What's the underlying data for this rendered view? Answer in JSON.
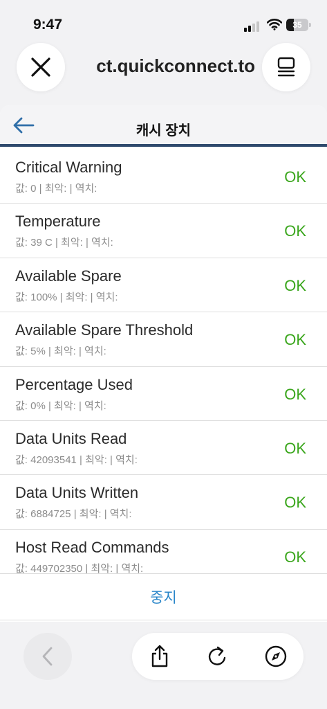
{
  "status_bar": {
    "time": "9:47",
    "battery": "35",
    "battery_level": 0.35
  },
  "browser": {
    "url": "ct.quickconnect.to"
  },
  "page": {
    "title": "캐시 장치"
  },
  "attributes": [
    {
      "name": "Critical Warning",
      "detail": "값: 0 | 최악: | 역치:",
      "status": "OK"
    },
    {
      "name": "Temperature",
      "detail": "값: 39 C | 최악: | 역치:",
      "status": "OK"
    },
    {
      "name": "Available Spare",
      "detail": "값: 100% | 최악: | 역치:",
      "status": "OK"
    },
    {
      "name": "Available Spare Threshold",
      "detail": "값: 5% | 최악: | 역치:",
      "status": "OK"
    },
    {
      "name": "Percentage Used",
      "detail": "값: 0% | 최악: | 역치:",
      "status": "OK"
    },
    {
      "name": "Data Units Read",
      "detail": "값: 42093541 | 최악: | 역치:",
      "status": "OK"
    },
    {
      "name": "Data Units Written",
      "detail": "값: 6884725 | 최악: | 역치:",
      "status": "OK"
    },
    {
      "name": "Host Read Commands",
      "detail": "값: 449702350 | 최악: | 역치:",
      "status": "OK"
    }
  ],
  "footer": {
    "stop_label": "중지"
  },
  "colors": {
    "ok": "#3aa61c",
    "link": "#2a86c9",
    "header_line": "#2f4a6d",
    "back_arrow": "#2f6ea8"
  },
  "icons": {
    "close": "close-icon",
    "tabs": "tabs-icon",
    "back": "arrow-left-icon",
    "nav_back": "chevron-left-icon",
    "share": "share-icon",
    "reload": "reload-icon",
    "compass": "compass-icon"
  }
}
